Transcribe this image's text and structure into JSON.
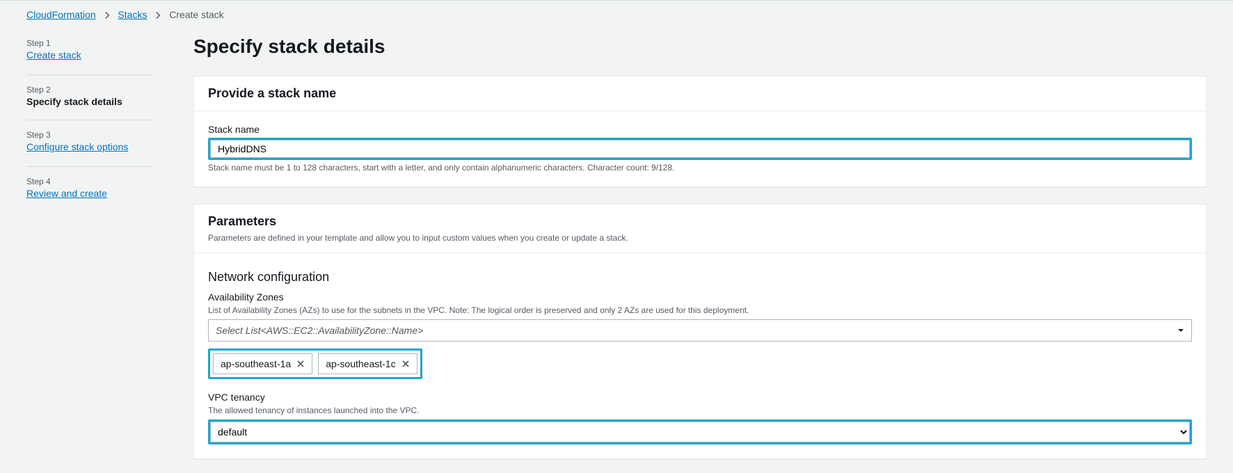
{
  "breadcrumb": {
    "items": [
      {
        "label": "CloudFormation",
        "link": true
      },
      {
        "label": "Stacks",
        "link": true
      },
      {
        "label": "Create stack",
        "link": false
      }
    ]
  },
  "wizard": {
    "steps": [
      {
        "num": "Step 1",
        "title": "Create stack",
        "current": false
      },
      {
        "num": "Step 2",
        "title": "Specify stack details",
        "current": true
      },
      {
        "num": "Step 3",
        "title": "Configure stack options",
        "current": false
      },
      {
        "num": "Step 4",
        "title": "Review and create",
        "current": false
      }
    ]
  },
  "page": {
    "title": "Specify stack details"
  },
  "stackName": {
    "panel_title": "Provide a stack name",
    "field_label": "Stack name",
    "value": "HybridDNS",
    "helper": "Stack name must be 1 to 128 characters, start with a letter, and only contain alphanumeric characters. Character count: 9/128."
  },
  "parameters": {
    "panel_title": "Parameters",
    "panel_subtext": "Parameters are defined in your template and allow you to input custom values when you create or update a stack.",
    "network_section_title": "Network configuration",
    "az": {
      "label": "Availability Zones",
      "sublabel": "List of Availability Zones (AZs) to use for the subnets in the VPC. Note: The logical order is preserved and only 2 AZs are used for this deployment.",
      "placeholder": "Select List<AWS::EC2::AvailabilityZone::Name>",
      "tokens": [
        "ap-southeast-1a",
        "ap-southeast-1c"
      ]
    },
    "vpc_tenancy": {
      "label": "VPC tenancy",
      "sublabel": "The allowed tenancy of instances launched into the VPC.",
      "value": "default"
    }
  }
}
